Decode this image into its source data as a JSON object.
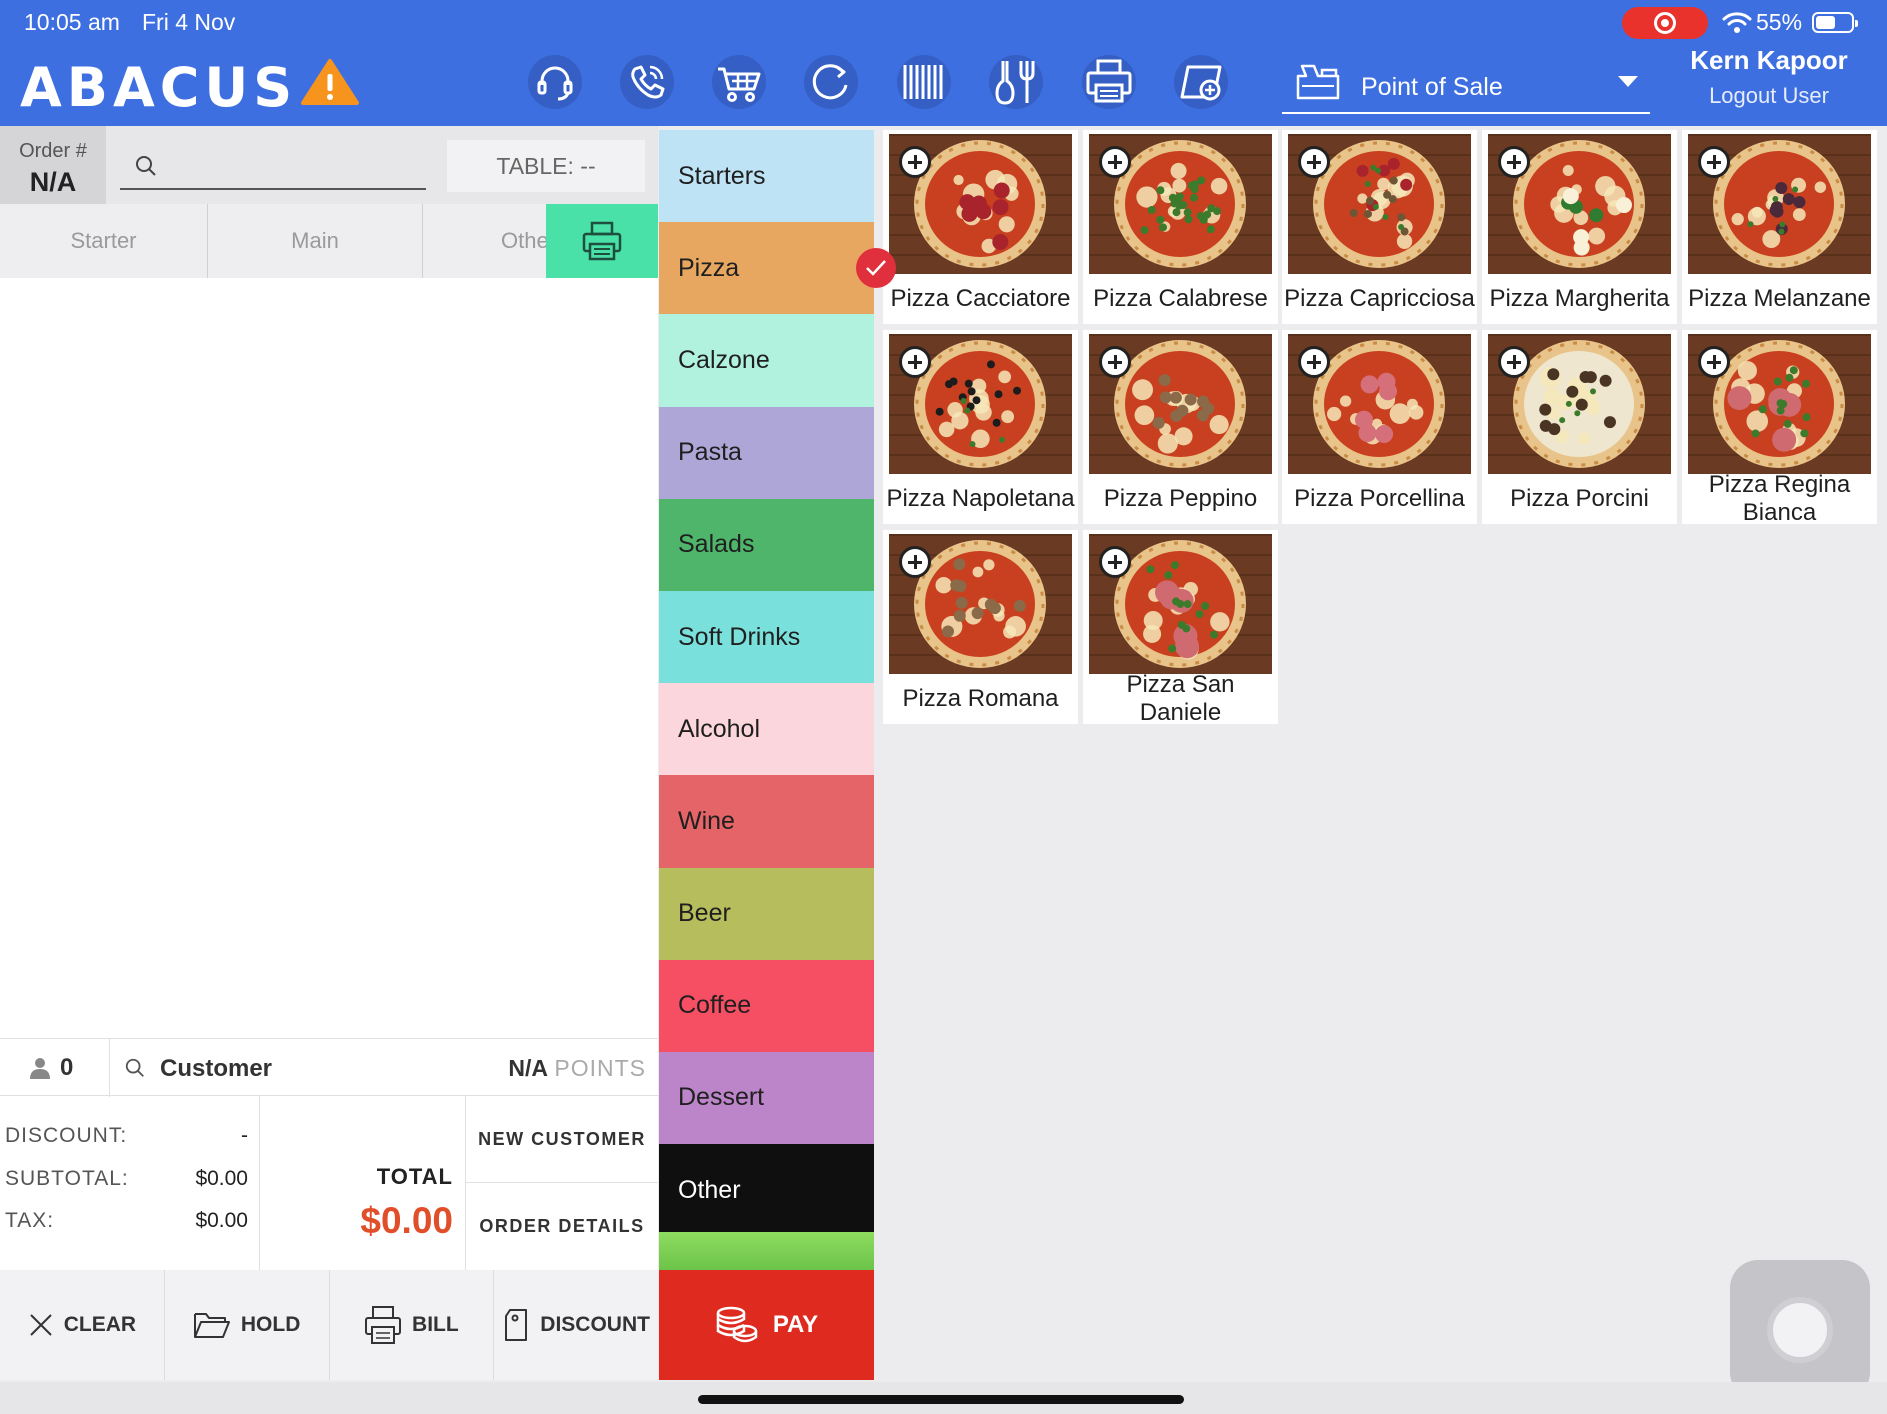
{
  "status_bar": {
    "time": "10:05 am",
    "date": "Fri 4 Nov",
    "battery_text": "55%",
    "battery_level": 0.55,
    "record_color": "#e8322b"
  },
  "header": {
    "logo": "ABACUS",
    "brand_color": "#3d6fe0",
    "warning_color": "#f7941d",
    "toolbar_icons": [
      "support-icon",
      "phone-icon",
      "cart-icon",
      "refresh-icon",
      "barcode-icon",
      "kitchen-icon",
      "printer-icon",
      "add-device-icon"
    ],
    "mode": "Point of Sale",
    "user_name": "Kern Kapoor",
    "logout_label": "Logout User"
  },
  "order": {
    "order_label": "Order #",
    "order_value": "N/A",
    "search_placeholder": "",
    "table_label": "TABLE: --",
    "course_tabs": [
      "Starter",
      "Main",
      "Other"
    ],
    "guests": "0",
    "customer_label": "Customer",
    "points_value": "N/A",
    "points_unit": "POINTS",
    "discount_label": "DISCOUNT:",
    "discount_value": "-",
    "subtotal_label": "SUBTOTAL:",
    "subtotal_value": "$0.00",
    "tax_label": "TAX:",
    "tax_value": "$0.00",
    "total_label": "TOTAL",
    "total_value": "$0.00",
    "new_customer_label": "NEW CUSTOMER",
    "order_details_label": "ORDER DETAILS"
  },
  "actions": [
    {
      "label": "CLEAR",
      "icon": "close-icon"
    },
    {
      "label": "HOLD",
      "icon": "folder-icon"
    },
    {
      "label": "BILL",
      "icon": "printer-icon"
    },
    {
      "label": "DISCOUNT",
      "icon": "tag-icon"
    }
  ],
  "pay_label": "PAY",
  "pay_color": "#de2a1f",
  "categories": [
    {
      "label": "Starters",
      "color": "#bee3f5"
    },
    {
      "label": "Pizza",
      "color": "#e8a760",
      "selected": true
    },
    {
      "label": "Calzone",
      "color": "#b0f2de"
    },
    {
      "label": "Pasta",
      "color": "#aea6d6"
    },
    {
      "label": "Salads",
      "color": "#4fb56b"
    },
    {
      "label": "Soft Drinks",
      "color": "#7ae0dc"
    },
    {
      "label": "Alcohol",
      "color": "#fbd6dd"
    },
    {
      "label": "Wine",
      "color": "#e46468"
    },
    {
      "label": "Beer",
      "color": "#b6bd5c"
    },
    {
      "label": "Coffee",
      "color": "#f64e63"
    },
    {
      "label": "Dessert",
      "color": "#bd85c9"
    },
    {
      "label": "Other",
      "color": "#0f0f0f",
      "dark": true
    }
  ],
  "products": [
    {
      "name": "Pizza Cacciatore",
      "topping": "salami"
    },
    {
      "name": "Pizza Calabrese",
      "topping": "rocket"
    },
    {
      "name": "Pizza Capricciosa",
      "topping": "mixed"
    },
    {
      "name": "Pizza Margherita",
      "topping": "basil"
    },
    {
      "name": "Pizza Melanzane",
      "topping": "eggplant"
    },
    {
      "name": "Pizza Napoletana",
      "topping": "olives"
    },
    {
      "name": "Pizza Peppino",
      "topping": "mushroom"
    },
    {
      "name": "Pizza Porcellina",
      "topping": "ham"
    },
    {
      "name": "Pizza Porcini",
      "topping": "bianca"
    },
    {
      "name": "Pizza Regina Bianca",
      "topping": "prosciutto"
    },
    {
      "name": "Pizza Romana",
      "topping": "mushroom"
    },
    {
      "name": "Pizza San Daniele",
      "topping": "prosciutto"
    }
  ]
}
